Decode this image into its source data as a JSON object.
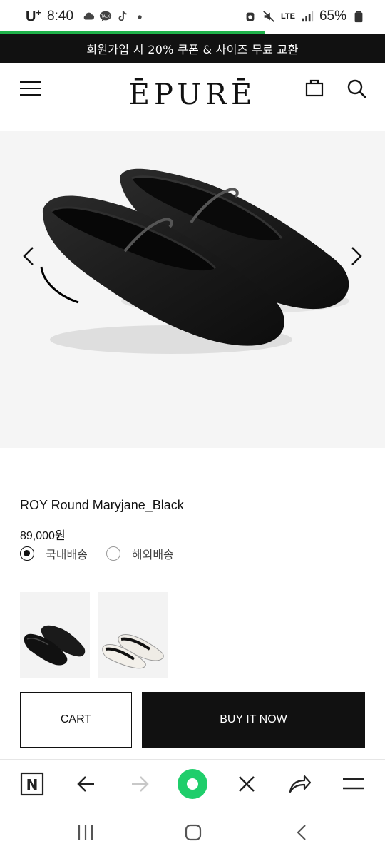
{
  "status_bar": {
    "carrier": "U",
    "carrier_sup": "+",
    "time": "8:40",
    "network": "LTE",
    "battery": "65%"
  },
  "announcement": "회원가입 시 20% 쿠폰 & 사이즈 무료 교환",
  "header": {
    "logo": "ĒPURĒ"
  },
  "product": {
    "title": "ROY Round Maryjane_Black",
    "price": "89,000원",
    "shipping_options": [
      {
        "label": "국내배송",
        "selected": true
      },
      {
        "label": "해외배송",
        "selected": false
      }
    ]
  },
  "actions": {
    "cart_label": "CART",
    "buy_label": "BUY IT NOW"
  },
  "browser_toolbar": {
    "n_label": "N",
    "accent": "#1fce6b"
  },
  "colors": {
    "announce_bg": "#111111",
    "buy_bg": "#111111",
    "progress": "#1fb24a"
  }
}
